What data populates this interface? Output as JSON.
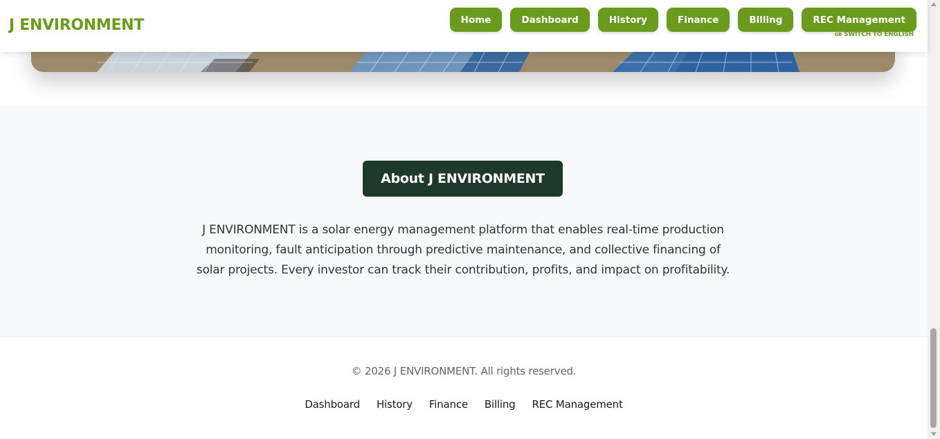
{
  "header": {
    "brand": "J ENVIRONMENT",
    "nav": [
      "Home",
      "Dashboard",
      "History",
      "Finance",
      "Billing",
      "REC Management"
    ],
    "lang_flag": "GB",
    "lang_switch": "SWITCH TO ENGLISH"
  },
  "about": {
    "title": "About J ENVIRONMENT",
    "text": "J ENVIRONMENT is a solar energy management platform that enables real-time production monitoring, fault anticipation through predictive maintenance, and collective financing of solar projects. Every investor can track their contribution, profits, and impact on profitability."
  },
  "footer": {
    "copyright": "© 2026 J ENVIRONMENT. All rights reserved.",
    "links": [
      "Dashboard",
      "History",
      "Finance",
      "Billing",
      "REC Management"
    ]
  },
  "colors": {
    "brand_green": "#6b9b1e",
    "dark_green": "#1d3a2a",
    "section_bg": "#f8f9fa"
  },
  "icons": {
    "hero": "solar-panels-image",
    "flag": "gb-flag-icon"
  }
}
